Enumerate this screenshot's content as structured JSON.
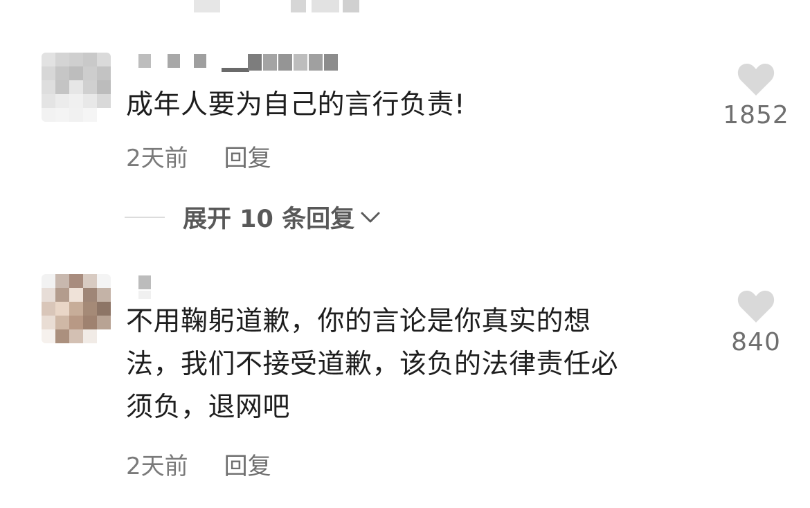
{
  "comments": [
    {
      "text": "成年人要为自己的言行负责!",
      "time": "2天前",
      "reply_label": "回复",
      "like_count": "1852",
      "expand_label": "展开 10 条回复"
    },
    {
      "text": "不用鞠躬道歉，你的言论是你真实的想\n法，我们不接受道歉，该负的法律责任必\n须负，退网吧",
      "time": "2天前",
      "reply_label": "回复",
      "like_count": "840"
    }
  ],
  "icons": {
    "like": "heart-icon",
    "expand": "chevron-down-icon"
  },
  "colors": {
    "heart": "#d9d9d9",
    "meta_text": "#7a7a7a",
    "body_text": "#1e1e1e"
  }
}
